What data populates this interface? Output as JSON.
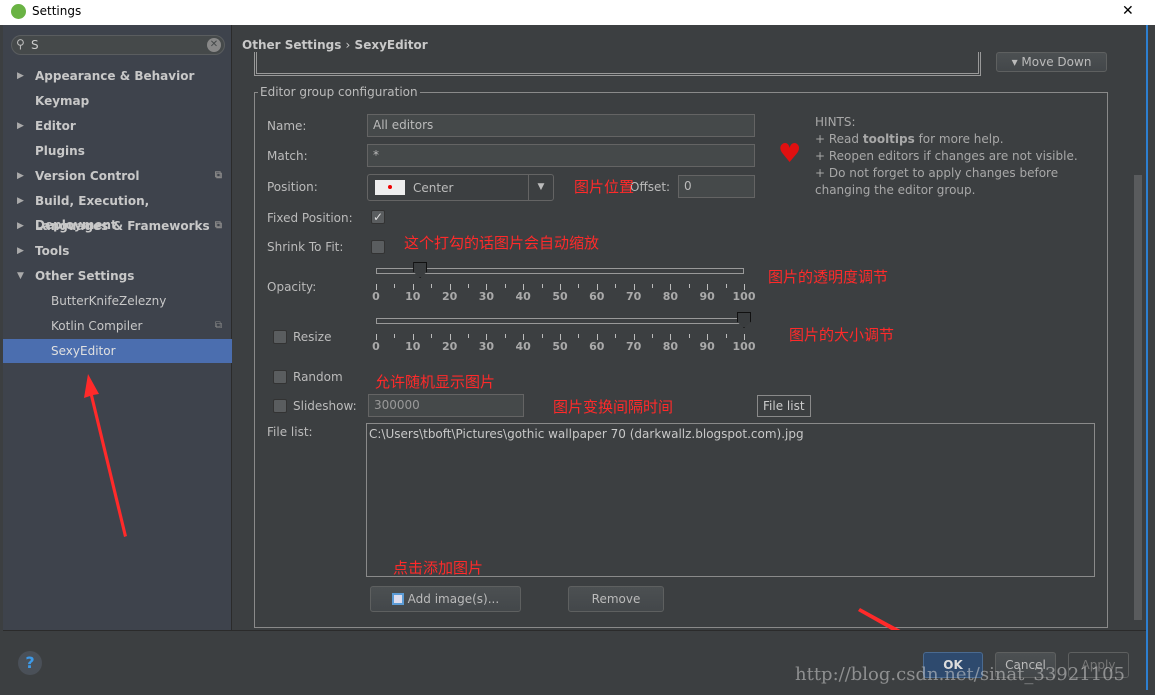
{
  "window": {
    "title": "Settings",
    "close": "✕"
  },
  "search": {
    "value": "S"
  },
  "sidebar": {
    "items": [
      {
        "label": "Appearance & Behavior",
        "expandable": true
      },
      {
        "label": "Keymap"
      },
      {
        "label": "Editor",
        "expandable": true
      },
      {
        "label": "Plugins"
      },
      {
        "label": "Version Control",
        "expandable": true,
        "project": true
      },
      {
        "label": "Build, Execution, Deployment",
        "expandable": true
      },
      {
        "label": "Languages & Frameworks",
        "expandable": true,
        "project": true
      },
      {
        "label": "Tools",
        "expandable": true
      },
      {
        "label": "Other Settings",
        "expanded": true
      },
      {
        "label": "ButterKnifeZelezny",
        "child": true
      },
      {
        "label": "Kotlin Compiler",
        "child": true,
        "project": true
      },
      {
        "label": "SexyEditor",
        "child": true,
        "selected": true
      }
    ]
  },
  "breadcrumb": {
    "parent": "Other Settings",
    "sep": "›",
    "current": "SexyEditor"
  },
  "move_down": "Move Down",
  "group": {
    "title": "Editor group configuration",
    "name_label": "Name:",
    "name_value": "All editors",
    "match_label": "Match:",
    "match_value": "*",
    "position_label": "Position:",
    "position_value": "Center",
    "offset_label": "Offset:",
    "offset_value": "0",
    "fixed_label": "Fixed Position:",
    "fixed_checked": true,
    "shrink_label": "Shrink To Fit:",
    "shrink_checked": false,
    "opacity_label": "Opacity:",
    "opacity_value": 12,
    "resize_label": "Resize",
    "resize_checked": false,
    "resize_value": 100,
    "ticks": [
      "0",
      "10",
      "20",
      "30",
      "40",
      "50",
      "60",
      "70",
      "80",
      "90",
      "100"
    ],
    "random_label": "Random",
    "random_checked": false,
    "slideshow_label": "Slideshow:",
    "slideshow_checked": false,
    "slideshow_value": "300000",
    "filelist_label": "File list:",
    "filelist_tooltip": "File list",
    "files": [
      "C:\\Users\\tboft\\Pictures\\gothic wallpaper 70 (darkwallz.blogspot.com).jpg"
    ],
    "add_label": "Add image(s)...",
    "remove_label": "Remove"
  },
  "hints": {
    "title": "HINTS:",
    "l1a": "+ Read ",
    "l1b": "tooltips",
    "l1c": " for more help.",
    "l2": "+ Reopen editors if changes are not visible.",
    "l3": "+ Do not forget to apply changes before",
    "l4": "changing the editor group."
  },
  "annotations": {
    "position": "图片位置",
    "shrink": "这个打勾的话图片会自动缩放",
    "opacity": "图片的透明度调节",
    "resize": "图片的大小调节",
    "random": "允许随机显示图片",
    "slideshow": "图片变换间隔时间",
    "add": "点击添加图片"
  },
  "footer": {
    "help": "?",
    "ok": "OK",
    "cancel": "Cancel",
    "apply": "Apply"
  },
  "watermark": "http://blog.csdn.net/sinat_33921105",
  "colors": {
    "selection": "#4b6eaf",
    "annotation": "#ff2a2a",
    "ok_button": "#2e4a6e"
  }
}
